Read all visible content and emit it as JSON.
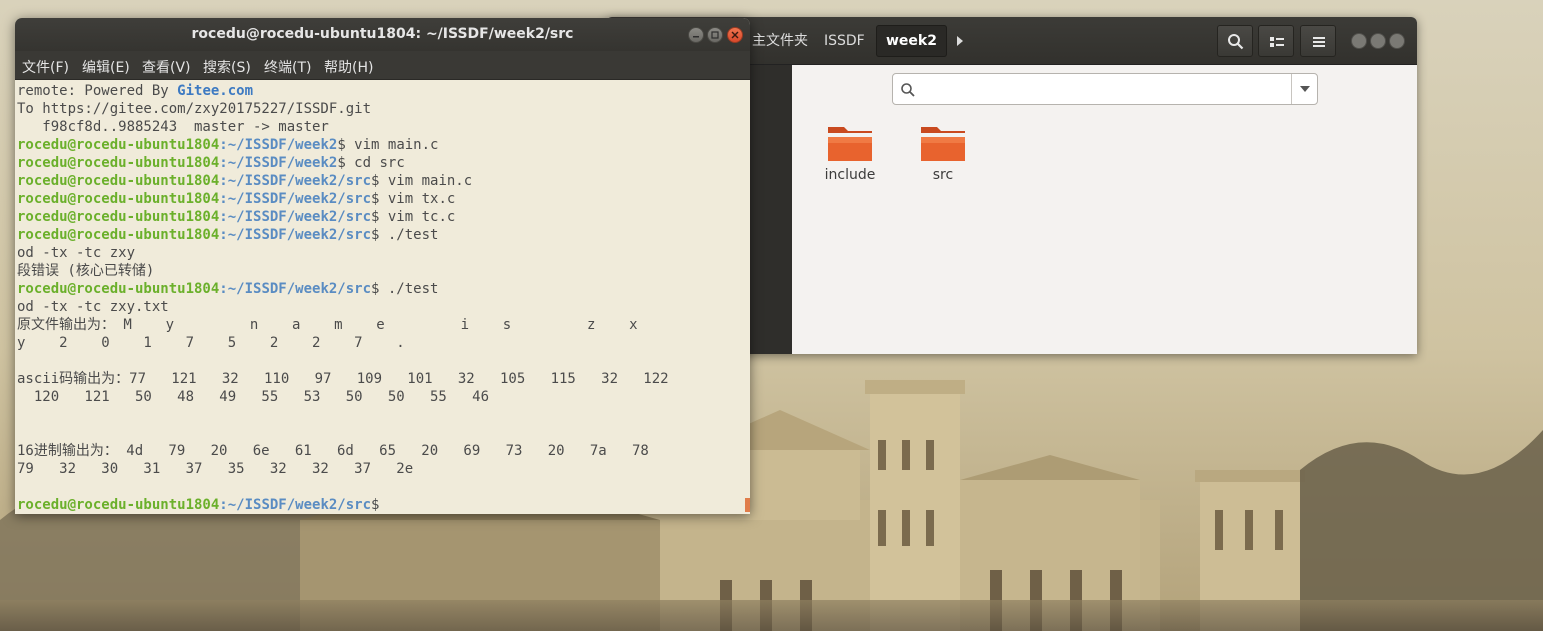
{
  "desktop": {
    "colors": {
      "sky": "#d7ccb0",
      "stone": "#c9b78e",
      "shadow": "#6a5d44"
    }
  },
  "file_manager": {
    "breadcrumbs": [
      {
        "label": "主文件夹"
      },
      {
        "label": "ISSDF"
      },
      {
        "label": "week2",
        "active": true
      }
    ],
    "search": {
      "value": "",
      "placeholder": ""
    },
    "folders": [
      {
        "label": "include",
        "icon": "folder-icon"
      },
      {
        "label": "src",
        "icon": "folder-icon"
      }
    ],
    "colors": {
      "header": "#3c3b37",
      "content": "#f4f2f0",
      "folder": "#e25c2a"
    }
  },
  "terminal": {
    "title": "rocedu@rocedu-ubuntu1804: ~/ISSDF/week2/src",
    "menu": [
      "文件(F)",
      "编辑(E)",
      "查看(V)",
      "搜索(S)",
      "终端(T)",
      "帮助(H)"
    ],
    "lines": {
      "l01": "remote: Powered By ",
      "l01_link": "Gitee.com",
      "l02": "To https://gitee.com/zxy20175227/ISSDF.git",
      "l03": "   f98cf8d..9885243  master -> master",
      "user": "rocedu@rocedu-ubuntu1804",
      "path_week2": ":~/ISSDF/week2",
      "path_src": ":~/ISSDF/week2/src",
      "c04": "$ vim main.c",
      "c05": "$ cd src",
      "c06": "$ vim main.c",
      "c07": "$ vim tx.c",
      "c08": "$ vim tc.c",
      "c09": "$ ./test",
      "l10": "od -tx -tc zxy",
      "l11": "段错误 (核心已转储)",
      "c12": "$ ./test",
      "l13": "od -tx -tc zxy.txt",
      "l14": "原文件输出为： M    y         n    a    m    e         i    s         z    x",
      "l15": "y    2    0    1    7    5    2    2    7    .",
      "l16": "",
      "l17": "ascii码输出为：77   121   32   110   97   109   101   32   105   115   32   122",
      "l18": "  120   121   50   48   49   55   53   50   50   55   46",
      "l19": "",
      "l20": "",
      "l21": "16进制输出为： 4d   79   20   6e   61   6d   65   20   69   73   20   7a   78",
      "l22": "79   32   30   31   37   35   32   32   37   2e",
      "l23": "",
      "c24": "$"
    },
    "colors": {
      "background": "#f0ebda",
      "user": "#6bb02b",
      "path": "#5a8cc2",
      "text": "#4b4b4b",
      "cursor": "#e07d4a"
    }
  }
}
